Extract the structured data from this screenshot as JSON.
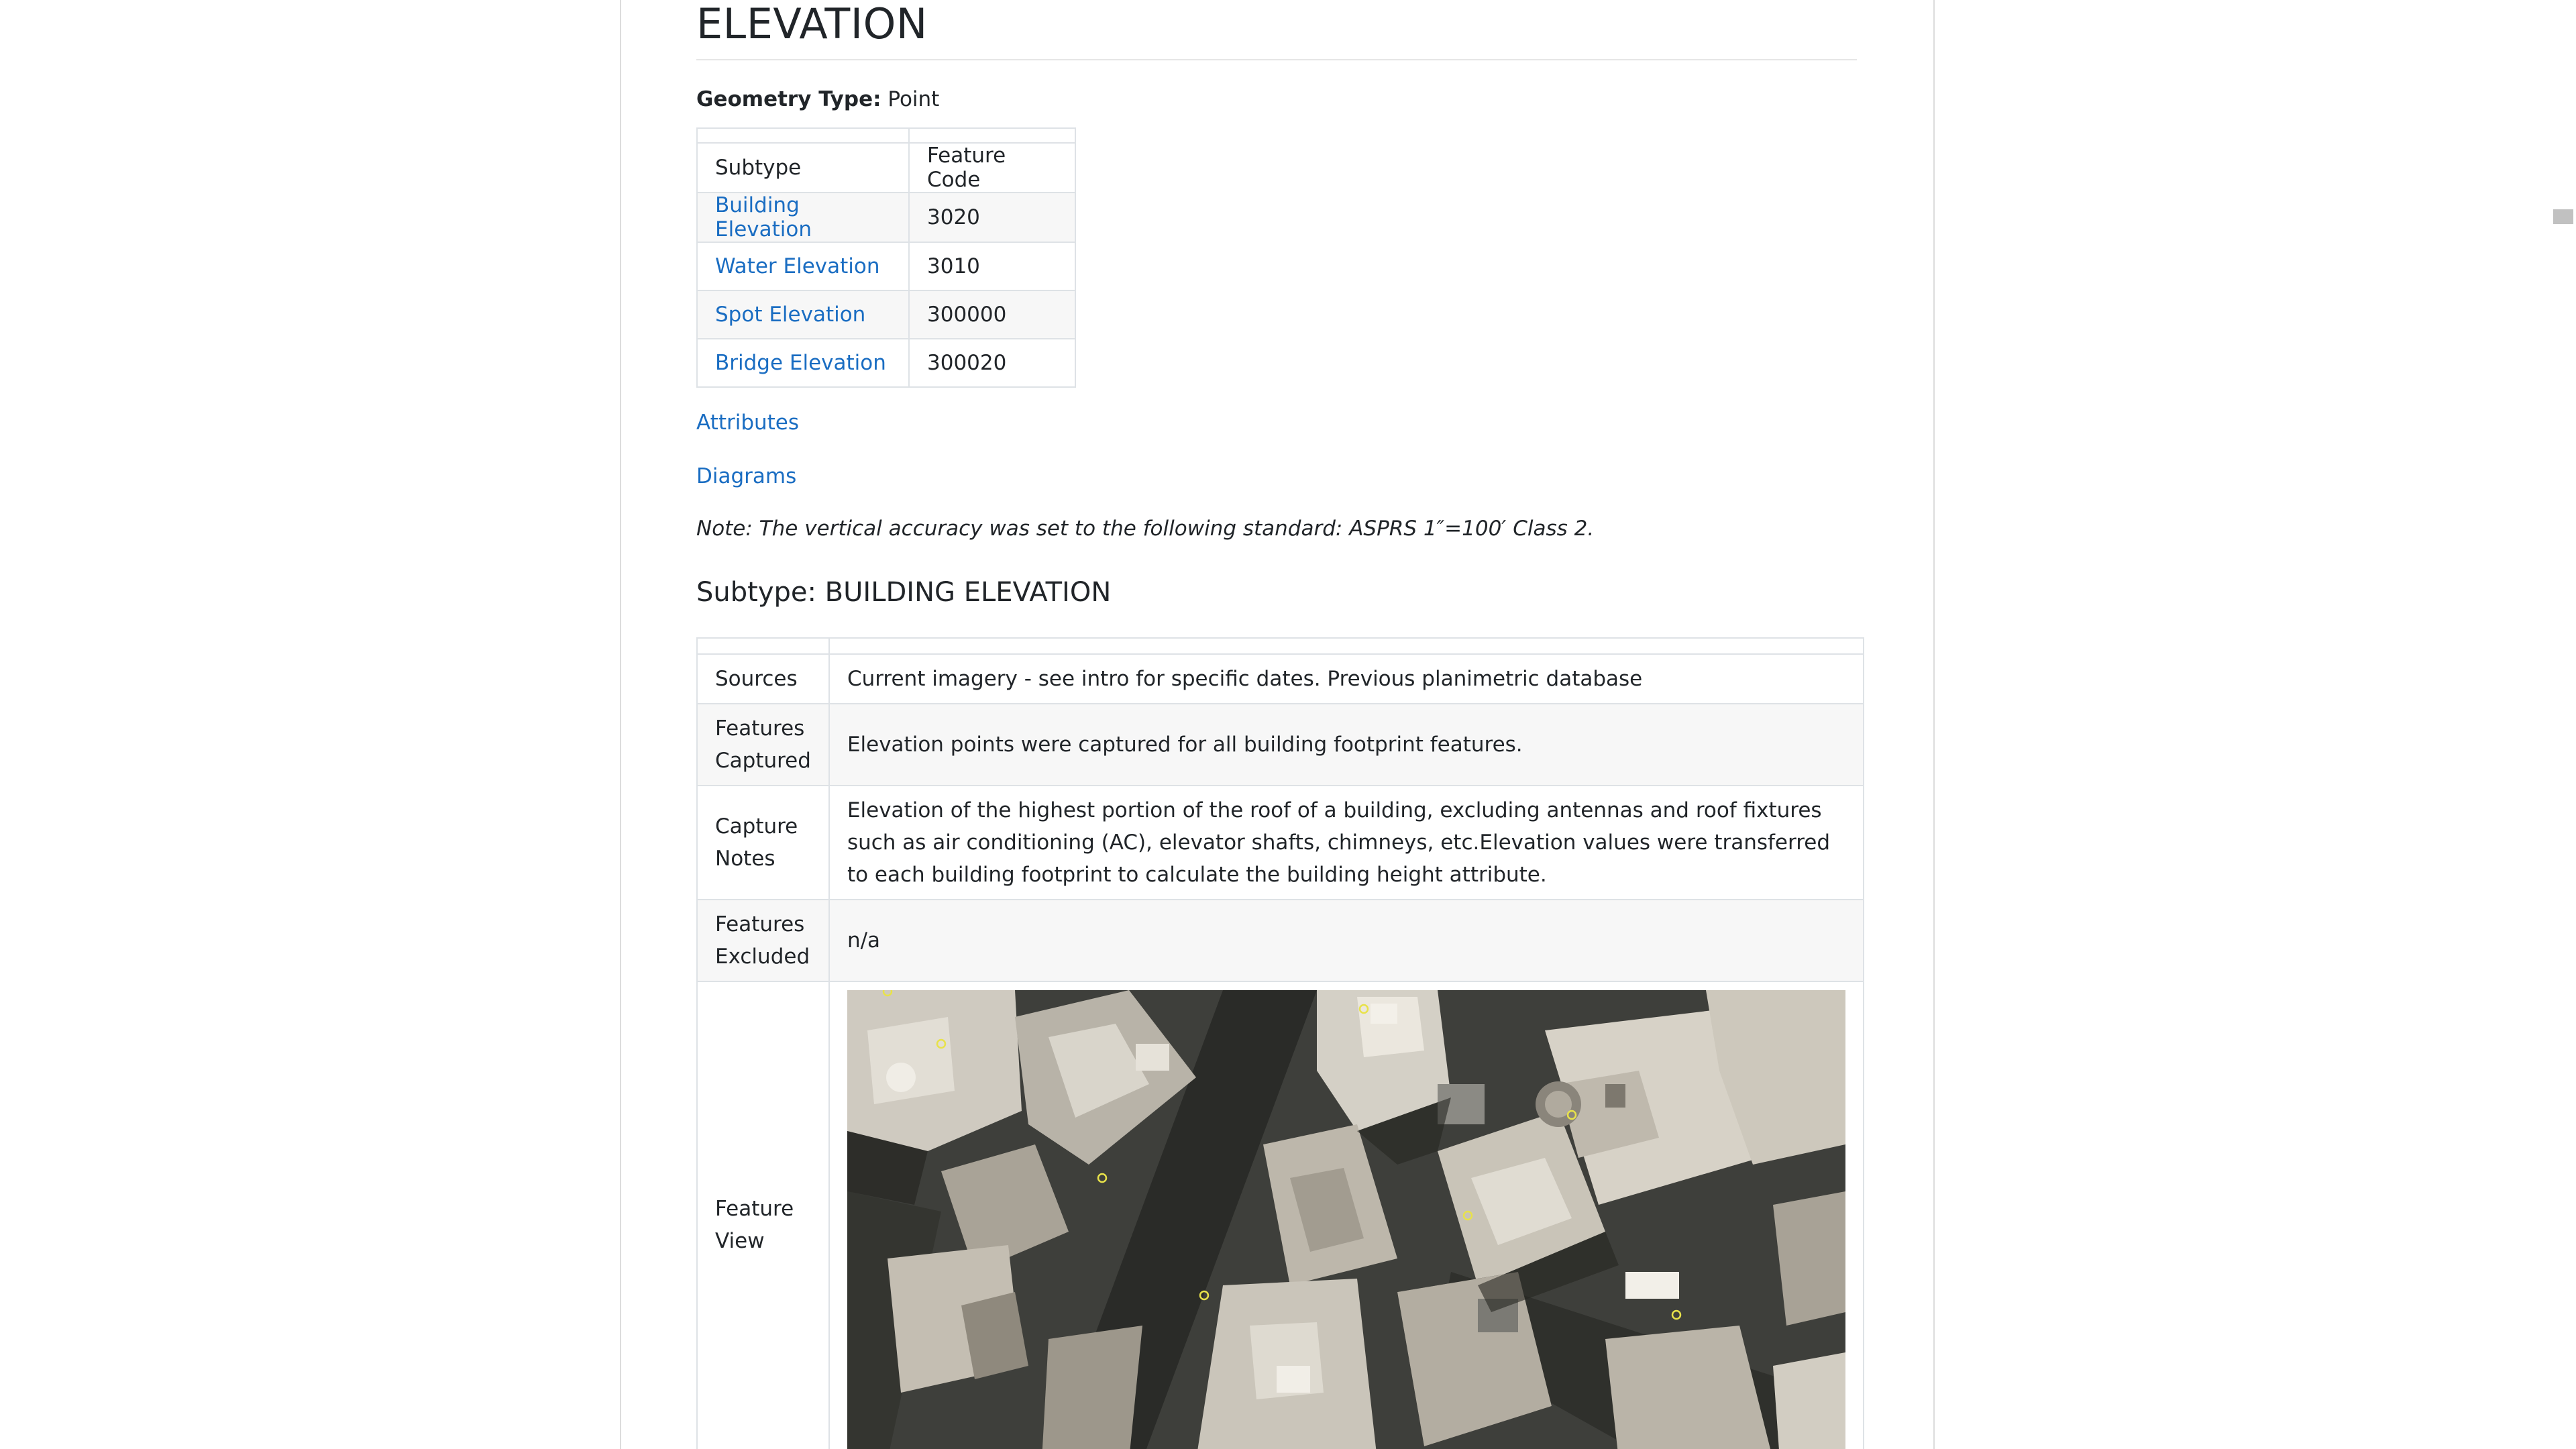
{
  "page": {
    "title": "ELEVATION",
    "geometry_label": "Geometry Type:",
    "geometry_value": "Point"
  },
  "subtype_table": {
    "headers": [
      "Subtype",
      "Feature Code"
    ],
    "rows": [
      {
        "subtype": "Building Elevation",
        "code": "3020"
      },
      {
        "subtype": "Water Elevation",
        "code": "3010"
      },
      {
        "subtype": "Spot Elevation",
        "code": "300000"
      },
      {
        "subtype": "Bridge Elevation",
        "code": "300020"
      }
    ]
  },
  "links": {
    "attributes": "Attributes",
    "diagrams": "Diagrams"
  },
  "note": "Note: The vertical accuracy was set to the following standard: ASPRS 1″=100′ Class 2.",
  "subtype_section": {
    "heading": "Subtype: BUILDING ELEVATION",
    "rows": [
      {
        "label": "Sources",
        "value": "Current imagery - see intro for specific dates. Previous planimetric database"
      },
      {
        "label": "Features Captured",
        "value": "Elevation points were captured for all building footprint features."
      },
      {
        "label": "Capture Notes",
        "value": "Elevation of the highest portion of the roof of a building, excluding antennas and roof fixtures such as air conditioning (AC), elevator shafts, chimneys, etc.Elevation values were transferred to each building footprint to calculate the building height attribute."
      },
      {
        "label": "Features Excluded",
        "value": "n/a"
      },
      {
        "label": "Feature View",
        "value": ""
      }
    ]
  },
  "colors": {
    "link": "#1a6dc2",
    "stripe": "#f7f7f7",
    "border": "#dee2e6",
    "marker": "#e8e24a"
  }
}
